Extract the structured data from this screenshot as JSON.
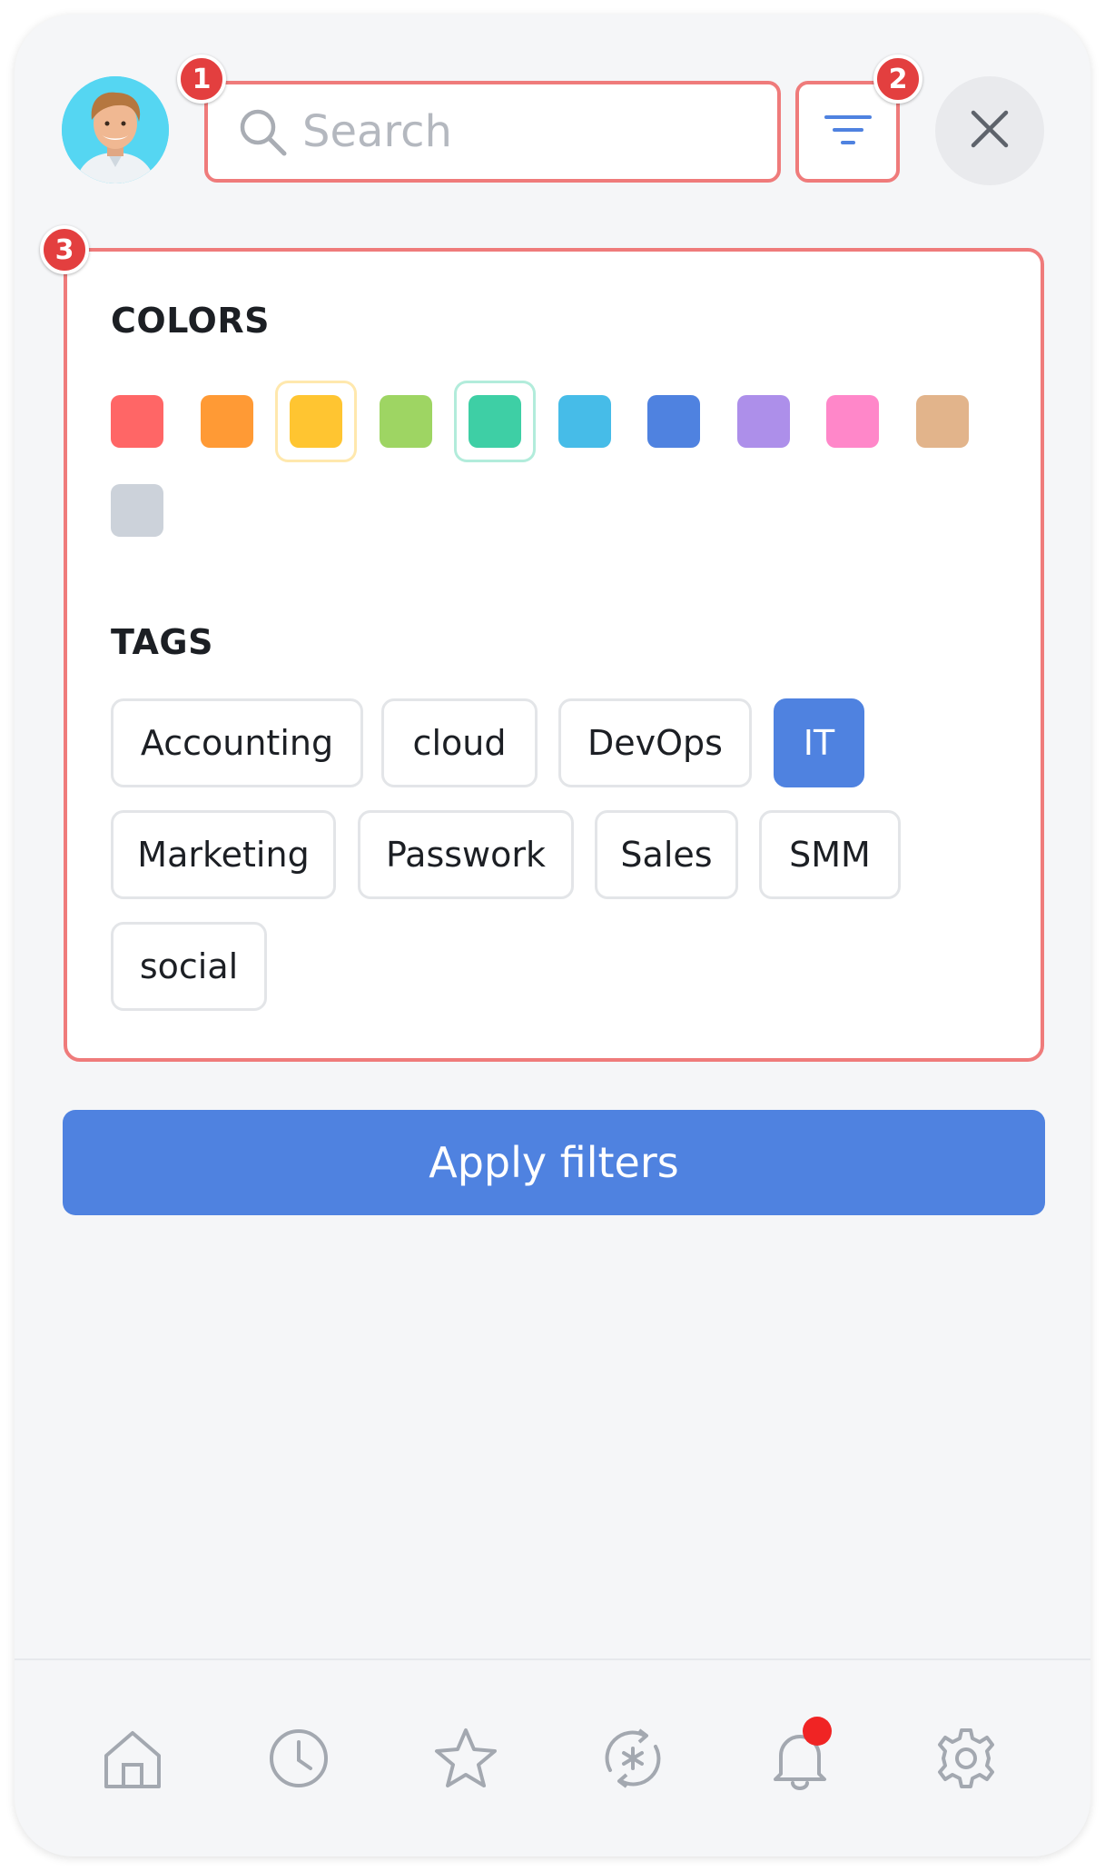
{
  "header": {
    "search": {
      "placeholder": "Search",
      "value": ""
    },
    "icons": {
      "avatar": "user-avatar",
      "search": "search-icon",
      "filter": "filter-icon",
      "close": "close-icon"
    }
  },
  "callouts": [
    "1",
    "2",
    "3"
  ],
  "filters": {
    "colors_title": "COLORS",
    "colors": [
      "#ff6666",
      "#ff9a35",
      "#ffc531",
      "#9ed563",
      "#3ecfa5",
      "#46bce8",
      "#4f82e0",
      "#ad8fea",
      "#ff87c9",
      "#e2b48b",
      "#ccd2da"
    ],
    "selected_colors": [
      "#ffc531",
      "#3ecfa5"
    ],
    "tags_title": "TAGS",
    "tags": [
      {
        "label": "Accounting",
        "active": false
      },
      {
        "label": "cloud",
        "active": false
      },
      {
        "label": "DevOps",
        "active": false
      },
      {
        "label": "IT",
        "active": true
      },
      {
        "label": "Marketing",
        "active": false
      },
      {
        "label": "Passwork",
        "active": false
      },
      {
        "label": "Sales",
        "active": false
      },
      {
        "label": "SMM",
        "active": false
      },
      {
        "label": "social",
        "active": false
      }
    ]
  },
  "apply_button": {
    "label": "Apply filters"
  },
  "bottom_nav": {
    "items": [
      "home-icon",
      "clock-icon",
      "star-icon",
      "generator-icon",
      "bell-icon",
      "gear-icon"
    ],
    "notification_dot_color": "#f02424"
  },
  "theme": {
    "accent": "#4f82e0",
    "callout": "#e33f3f",
    "highlight_border": "#ef7b7b"
  }
}
